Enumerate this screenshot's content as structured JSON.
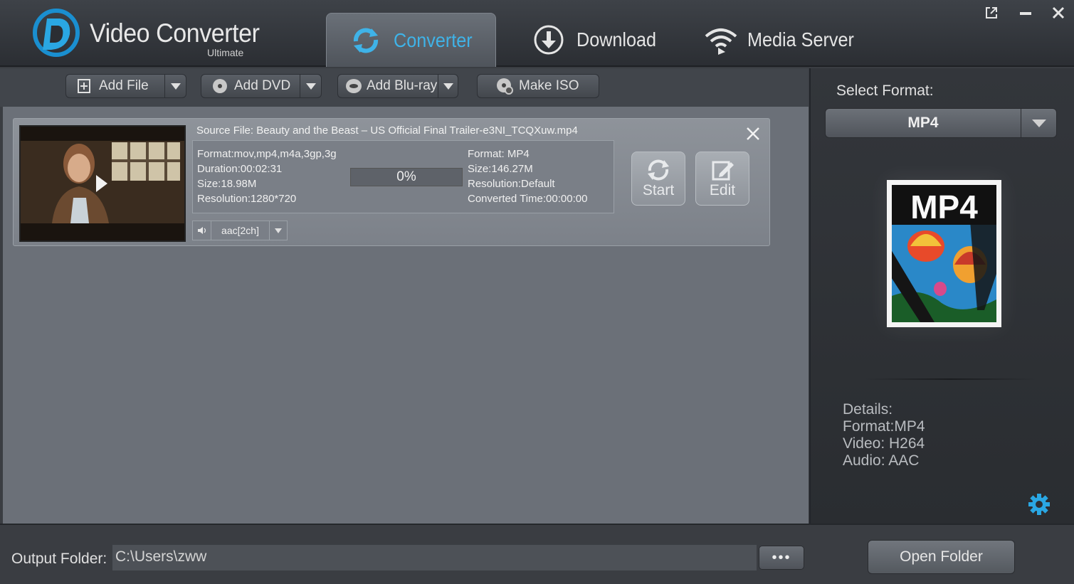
{
  "app": {
    "title": "Video Converter",
    "subtitle": "Ultimate"
  },
  "tabs": [
    {
      "label": "Converter",
      "icon": "refresh-icon",
      "active": true
    },
    {
      "label": "Download",
      "icon": "download-icon",
      "active": false
    },
    {
      "label": "Media Server",
      "icon": "wifi-icon",
      "active": false
    }
  ],
  "window_controls": [
    "popout-icon",
    "minimize-icon",
    "close-icon"
  ],
  "toolbar": {
    "add_file": "Add File",
    "add_dvd": "Add DVD",
    "add_bluray": "Add Blu-ray",
    "make_iso": "Make ISO"
  },
  "file_item": {
    "source": "Source File: Beauty and the Beast – US Official Final Trailer-e3NI_TCQXuw.mp4",
    "src_format": "Format:mov,mp4,m4a,3gp,3g",
    "src_duration": "Duration:00:02:31",
    "src_size": "Size:18.98M",
    "src_resolution": "Resolution:1280*720",
    "progress": "0%",
    "progress_value": 0,
    "out_format": "Format: MP4",
    "out_size": "Size:146.27M",
    "out_resolution": "Resolution:Default",
    "out_time": "Converted Time:00:00:00",
    "start_label": "Start",
    "edit_label": "Edit",
    "audio_track": "aac[2ch]"
  },
  "format_panel": {
    "select_label": "Select Format:",
    "selected": "MP4",
    "image_text": "MP4",
    "details": {
      "heading": "Details:",
      "format": "Format:MP4",
      "video": "Video: H264",
      "audio": "Audio: AAC"
    }
  },
  "bottom": {
    "output_label": "Output Folder:",
    "output_path": "C:\\Users\\zww",
    "browse_label": "•••",
    "open_folder": "Open Folder"
  },
  "colors": {
    "accent": "#3fb3e8",
    "panel": "#6b7078",
    "dark": "#2b2e33"
  }
}
